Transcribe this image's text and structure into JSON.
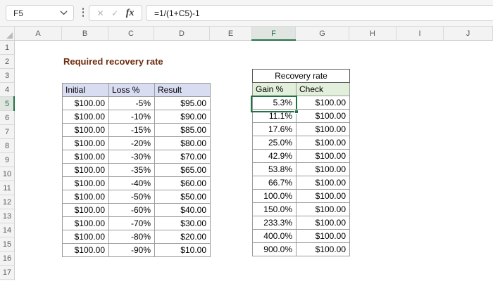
{
  "formula_bar": {
    "cell_reference": "F5",
    "formula": "=1/(1+C5)-1",
    "cancel_label": "✕",
    "enter_label": "✓",
    "fx_label": "fx"
  },
  "grid": {
    "column_headers": [
      "A",
      "B",
      "C",
      "D",
      "E",
      "F",
      "G",
      "H",
      "I",
      "J"
    ],
    "row_headers": [
      "1",
      "2",
      "3",
      "4",
      "5",
      "6",
      "7",
      "8",
      "9",
      "10",
      "11",
      "12",
      "13",
      "14",
      "15",
      "16",
      "17"
    ],
    "selected_column": "F",
    "selected_row": "5",
    "selected_cell": "F5"
  },
  "sheet": {
    "title": "Required recovery rate",
    "left_table": {
      "headers": [
        "Initial",
        "Loss %",
        "Result"
      ],
      "rows": [
        [
          "$100.00",
          "-5%",
          "$95.00"
        ],
        [
          "$100.00",
          "-10%",
          "$90.00"
        ],
        [
          "$100.00",
          "-15%",
          "$85.00"
        ],
        [
          "$100.00",
          "-20%",
          "$80.00"
        ],
        [
          "$100.00",
          "-30%",
          "$70.00"
        ],
        [
          "$100.00",
          "-35%",
          "$65.00"
        ],
        [
          "$100.00",
          "-40%",
          "$60.00"
        ],
        [
          "$100.00",
          "-50%",
          "$50.00"
        ],
        [
          "$100.00",
          "-60%",
          "$40.00"
        ],
        [
          "$100.00",
          "-70%",
          "$30.00"
        ],
        [
          "$100.00",
          "-80%",
          "$20.00"
        ],
        [
          "$100.00",
          "-90%",
          "$10.00"
        ]
      ]
    },
    "right_table": {
      "title": "Recovery rate",
      "headers": [
        "Gain %",
        "Check"
      ],
      "rows": [
        [
          "5.3%",
          "$100.00"
        ],
        [
          "11.1%",
          "$100.00"
        ],
        [
          "17.6%",
          "$100.00"
        ],
        [
          "25.0%",
          "$100.00"
        ],
        [
          "42.9%",
          "$100.00"
        ],
        [
          "53.8%",
          "$100.00"
        ],
        [
          "66.7%",
          "$100.00"
        ],
        [
          "100.0%",
          "$100.00"
        ],
        [
          "150.0%",
          "$100.00"
        ],
        [
          "233.3%",
          "$100.00"
        ],
        [
          "400.0%",
          "$100.00"
        ],
        [
          "900.0%",
          "$100.00"
        ]
      ]
    }
  },
  "colors": {
    "accent_green": "#217346",
    "left_table_header_fill": "#D9DDF2",
    "right_table_header_fill": "#E2EFDA",
    "title_text": "#6E2D0E"
  }
}
